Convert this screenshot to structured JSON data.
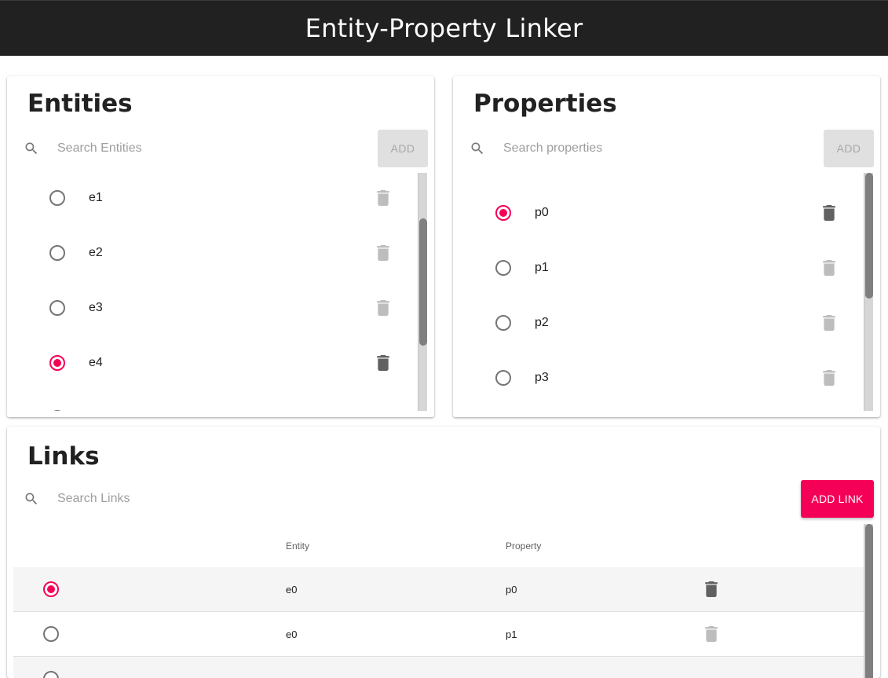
{
  "app": {
    "title": "Entity-Property Linker"
  },
  "entities": {
    "title": "Entities",
    "search_placeholder": "Search Entities",
    "add_label": "ADD",
    "items": [
      {
        "label": "e1",
        "selected": false
      },
      {
        "label": "e2",
        "selected": false
      },
      {
        "label": "e3",
        "selected": false
      },
      {
        "label": "e4",
        "selected": true
      }
    ]
  },
  "properties": {
    "title": "Properties",
    "search_placeholder": "Search properties",
    "add_label": "ADD",
    "items": [
      {
        "label": "p0",
        "selected": true
      },
      {
        "label": "p1",
        "selected": false
      },
      {
        "label": "p2",
        "selected": false
      },
      {
        "label": "p3",
        "selected": false
      }
    ]
  },
  "links": {
    "title": "Links",
    "search_placeholder": "Search Links",
    "add_label": "ADD LINK",
    "columns": [
      "Entity",
      "Property"
    ],
    "rows": [
      {
        "entity": "e0",
        "property": "p0",
        "selected": true
      },
      {
        "entity": "e0",
        "property": "p1",
        "selected": false
      }
    ]
  },
  "colors": {
    "accent": "#f50057",
    "appbar": "#212121",
    "trash_active": "#616161",
    "trash_inactive": "#bdbdbd"
  },
  "icons": {
    "search": "search-icon",
    "delete": "trash-icon"
  }
}
